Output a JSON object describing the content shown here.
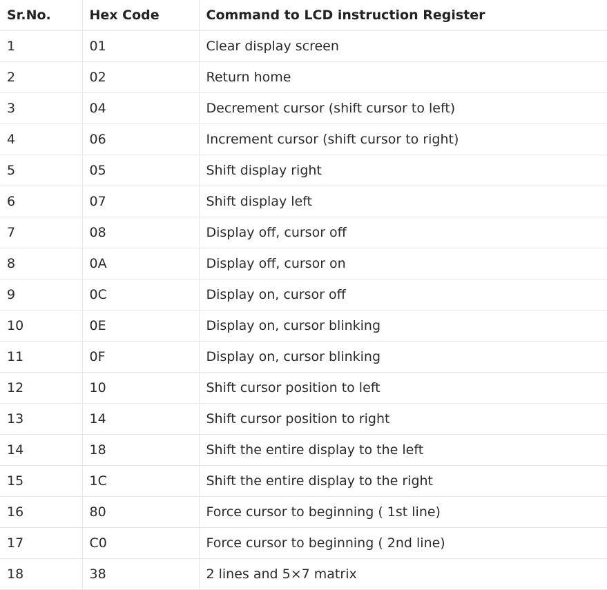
{
  "table": {
    "headers": [
      "Sr.No.",
      "Hex Code",
      "Command to LCD instruction Register"
    ],
    "rows": [
      [
        "1",
        "01",
        "Clear display screen"
      ],
      [
        "2",
        "02",
        "Return home"
      ],
      [
        "3",
        "04",
        "Decrement cursor (shift cursor to left)"
      ],
      [
        "4",
        "06",
        "Increment cursor (shift cursor to right)"
      ],
      [
        "5",
        "05",
        "Shift display right"
      ],
      [
        "6",
        "07",
        "Shift display left"
      ],
      [
        "7",
        "08",
        "Display off, cursor off"
      ],
      [
        "8",
        "0A",
        "Display off, cursor on"
      ],
      [
        "9",
        "0C",
        "Display on, cursor off"
      ],
      [
        "10",
        "0E",
        "Display on, cursor blinking"
      ],
      [
        "11",
        "0F",
        "Display on, cursor blinking"
      ],
      [
        "12",
        "10",
        "Shift cursor position to left"
      ],
      [
        "13",
        "14",
        "Shift cursor position to right"
      ],
      [
        "14",
        "18",
        "Shift the entire display to the left"
      ],
      [
        "15",
        "1C",
        "Shift the entire display to the right"
      ],
      [
        "16",
        "80",
        "Force cursor to beginning ( 1st line)"
      ],
      [
        "17",
        "C0",
        "Force cursor to beginning ( 2nd line)"
      ],
      [
        "18",
        "38",
        "2 lines and 5×7 matrix"
      ]
    ]
  }
}
